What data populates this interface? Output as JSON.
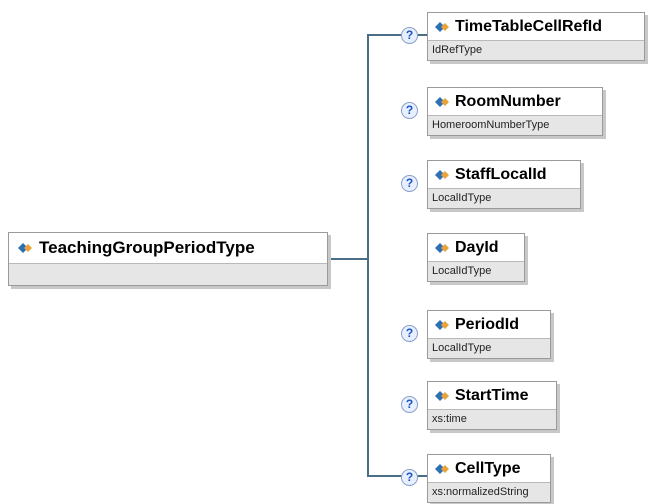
{
  "root": {
    "name": "TeachingGroupPeriodType"
  },
  "help_glyph": "?",
  "children": [
    {
      "name": "TimeTableCellRefId",
      "type": "IdRefType",
      "optional": true
    },
    {
      "name": "RoomNumber",
      "type": "HomeroomNumberType",
      "optional": true
    },
    {
      "name": "StaffLocalId",
      "type": "LocalIdType",
      "optional": true
    },
    {
      "name": "DayId",
      "type": "LocalIdType",
      "optional": false
    },
    {
      "name": "PeriodId",
      "type": "LocalIdType",
      "optional": true
    },
    {
      "name": "StartTime",
      "type": "xs:time",
      "optional": true
    },
    {
      "name": "CellType",
      "type": "xs:normalizedString",
      "optional": true
    }
  ],
  "colors": {
    "connector": "#4a6e86",
    "icon_blue": "#2f6fb3",
    "icon_orange": "#e8a33a"
  }
}
